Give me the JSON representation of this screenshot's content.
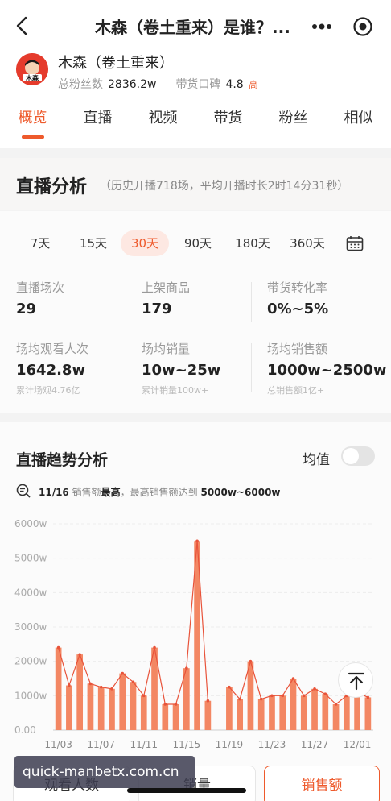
{
  "header": {
    "title": "木森（卷土重来）是谁？..."
  },
  "profile": {
    "avatar_text": "木森",
    "name": "木森（卷土重来）",
    "fans_label": "总粉丝数",
    "fans_value": "2836.2w",
    "rating_label": "带货口碑",
    "rating_value": "4.8",
    "rating_badge": "高"
  },
  "tabs": [
    {
      "label": "概览",
      "active": true
    },
    {
      "label": "直播",
      "active": false
    },
    {
      "label": "视频",
      "active": false
    },
    {
      "label": "带货",
      "active": false
    },
    {
      "label": "粉丝",
      "active": false
    },
    {
      "label": "相似",
      "active": false
    }
  ],
  "live_analysis": {
    "title": "直播分析",
    "subtitle": "（历史开播718场，平均开播时长2时14分31秒）",
    "periods": [
      "7天",
      "15天",
      "30天",
      "90天",
      "180天",
      "360天"
    ],
    "active_period": "30天",
    "metrics": [
      {
        "label": "直播场次",
        "value": "29",
        "note": ""
      },
      {
        "label": "上架商品",
        "value": "179",
        "note": ""
      },
      {
        "label": "带货转化率",
        "value": "0%~5%",
        "note": ""
      },
      {
        "label": "场均观看人次",
        "value": "1642.8w",
        "note": "累计场观4.76亿"
      },
      {
        "label": "场均销量",
        "value": "10w~25w",
        "note": "累计销量100w+"
      },
      {
        "label": "场均销售额",
        "value": "1000w~2500w",
        "note": "总销售额1亿+"
      }
    ]
  },
  "trend": {
    "title": "直播趋势分析",
    "avg_label": "均值",
    "insight_date": "11/16",
    "insight_metric": "销售额",
    "insight_highest": "最高",
    "insight_mid": "，最高销售额达到",
    "insight_range": "5000w~6000w"
  },
  "chart_data": {
    "type": "bar",
    "ylim": [
      0,
      6000
    ],
    "y_ticks": [
      "0.00",
      "1000w",
      "2000w",
      "3000w",
      "4000w",
      "5000w",
      "6000w"
    ],
    "x_tick_labels": [
      "11/03",
      "11/07",
      "11/11",
      "11/15",
      "11/19",
      "11/23",
      "11/27",
      "12/01"
    ],
    "categories": [
      "11/03",
      "11/04",
      "11/05",
      "11/06",
      "11/07",
      "11/08",
      "11/09",
      "11/10",
      "11/11",
      "11/12",
      "11/13",
      "11/14",
      "11/15",
      "11/16",
      "11/17",
      "11/18",
      "11/19",
      "11/20",
      "11/21",
      "11/22",
      "11/23",
      "11/24",
      "11/25",
      "11/26",
      "11/27",
      "11/28",
      "11/29",
      "11/30",
      "12/01",
      "12/02"
    ],
    "values": [
      2400,
      1300,
      2200,
      1350,
      1250,
      1200,
      1650,
      1400,
      1000,
      2400,
      750,
      750,
      1800,
      5500,
      850,
      null,
      1250,
      900,
      2000,
      900,
      1000,
      1000,
      1500,
      1000,
      1200,
      1050,
      750,
      1000,
      1100,
      950
    ],
    "color": "#f38763",
    "line_color": "#e8533a"
  },
  "bottom_tabs": [
    {
      "label": "观看人数",
      "active": false
    },
    {
      "label": "销量",
      "active": false
    },
    {
      "label": "销售额",
      "active": true
    }
  ],
  "watermark": "quick-manbetx.com.cn"
}
